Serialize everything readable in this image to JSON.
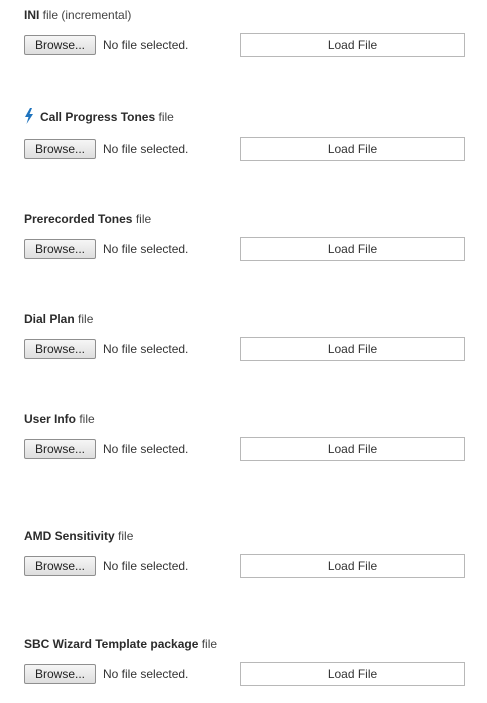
{
  "sections": [
    {
      "title_bold": "INI",
      "title_rest": " file (incremental)",
      "browse_label": "Browse...",
      "status": "No file selected.",
      "load_label": "Load File"
    },
    {
      "title_bold": "Call Progress Tones",
      "title_rest": " file",
      "browse_label": "Browse...",
      "status": "No file selected.",
      "load_label": "Load File",
      "icon": "lightning-icon"
    },
    {
      "title_bold": "Prerecorded Tones",
      "title_rest": " file",
      "browse_label": "Browse...",
      "status": "No file selected.",
      "load_label": "Load File"
    },
    {
      "title_bold": "Dial Plan",
      "title_rest": " file",
      "browse_label": "Browse...",
      "status": "No file selected.",
      "load_label": "Load File"
    },
    {
      "title_bold": "User Info",
      "title_rest": " file",
      "browse_label": "Browse...",
      "status": "No file selected.",
      "load_label": "Load File"
    },
    {
      "title_bold": "AMD Sensitivity",
      "title_rest": " file",
      "browse_label": "Browse...",
      "status": "No file selected.",
      "load_label": "Load File"
    },
    {
      "title_bold": "SBC Wizard Template package",
      "title_rest": " file",
      "browse_label": "Browse...",
      "status": "No file selected.",
      "load_label": "Load File"
    }
  ],
  "colors": {
    "bolt": "#1e73be",
    "text": "#333333",
    "border": "#b8b8b8"
  }
}
